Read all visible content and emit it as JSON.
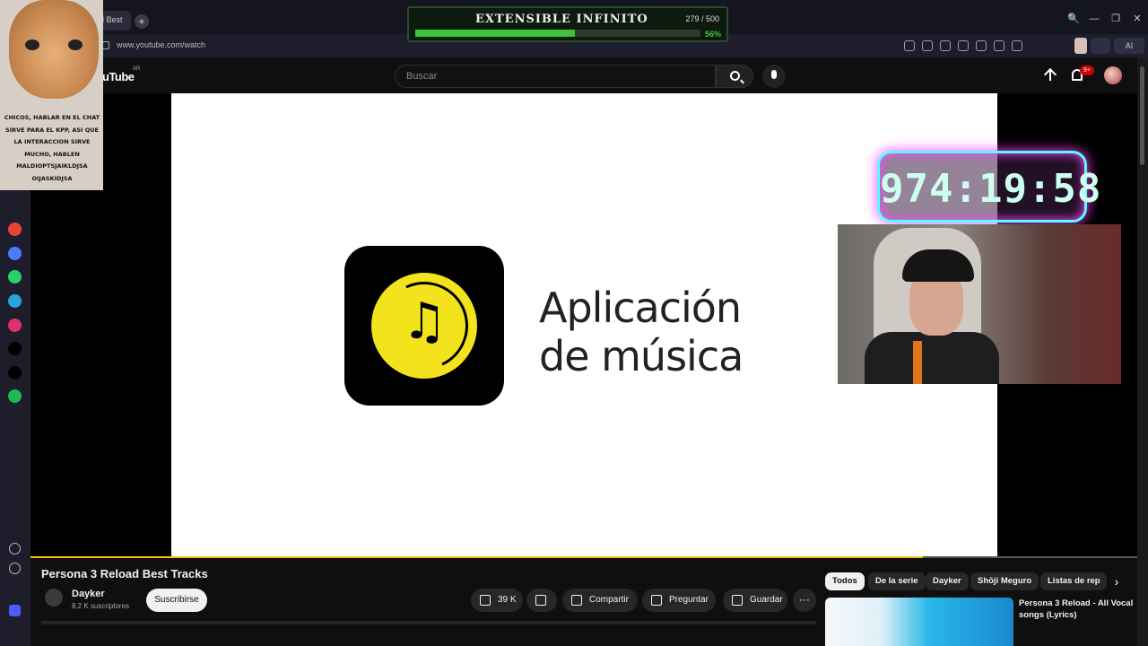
{
  "browser": {
    "tab_title": "ad Best",
    "new_tab_symbol": "+",
    "url": "www.youtube.com/watch",
    "ai_label": "AI",
    "window_controls": [
      "🔍",
      "—",
      "❐",
      "✕"
    ]
  },
  "sidebar": {
    "apps": [
      {
        "name": "gmail",
        "color": "#ea4335"
      },
      {
        "name": "messenger",
        "color": "#4c7cff"
      },
      {
        "name": "whatsapp",
        "color": "#25d366"
      },
      {
        "name": "telegram",
        "color": "#2aa3dd"
      },
      {
        "name": "instagram",
        "color": "#e1306c"
      },
      {
        "name": "tiktok",
        "color": "#000000"
      },
      {
        "name": "x",
        "color": "#000000"
      },
      {
        "name": "spotify",
        "color": "#1db954"
      }
    ]
  },
  "youtube": {
    "logo_text": "uTube",
    "country": "AR",
    "search_placeholder": "Buscar",
    "notifications_badge": "9+"
  },
  "video": {
    "title_line1": "Aplicación",
    "title_line2": "de música",
    "icon_glyph": "♫",
    "progress": 0.806,
    "accent": "#f2e31c"
  },
  "overlays": {
    "cat_caption": "CHICOS, HABLAR EN EL CHAT SIRVE PARA EL KPP, ASI QUE LA INTERACCION SIRVE MUCHO, HABLEN MALDIOPTSJAIKLDJSA OIJASKIDJSA",
    "goal_title": "EXTENSIBLE INFINITO",
    "goal_count": "279 / 500",
    "goal_percent": "56%",
    "goal_progress": 0.56,
    "timer": "974:19:58"
  },
  "watch": {
    "title": "Persona 3 Reload Best Tracks",
    "channel": "Dayker",
    "subscribers": "8,2 K suscriptores",
    "subscribe_label": "Suscribirse",
    "likes": "39 K",
    "share_label": "Compartir",
    "ask_label": "Preguntar",
    "save_label": "Guardar",
    "more_label": "···"
  },
  "related": {
    "chips": [
      "Todos",
      "De la serie",
      "Dayker",
      "Shōji Meguro",
      "Listas de rep"
    ],
    "next_symbol": "›",
    "first_title": "Persona 3 Reload - All Vocal songs (Lyrics)"
  }
}
